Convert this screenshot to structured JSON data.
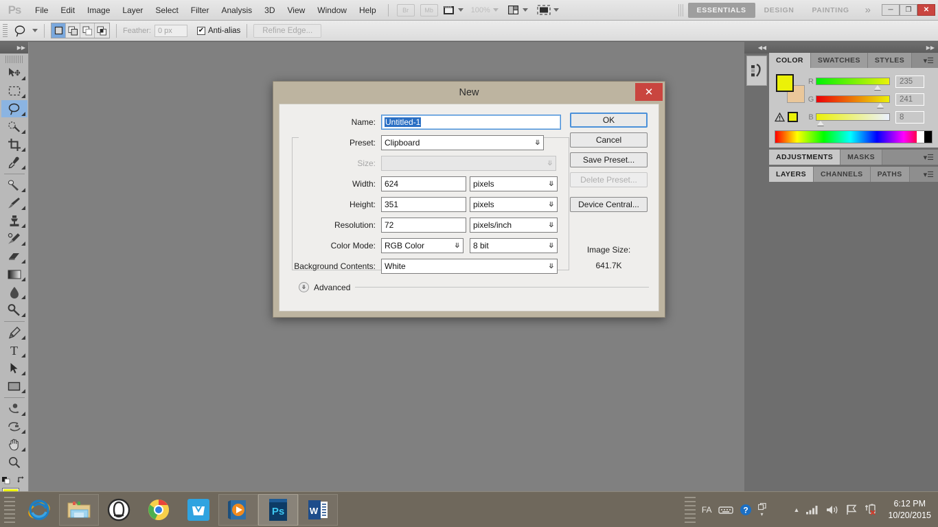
{
  "app": {
    "logo": "Ps"
  },
  "menubar": {
    "items": [
      "File",
      "Edit",
      "Image",
      "Layer",
      "Select",
      "Filter",
      "Analysis",
      "3D",
      "View",
      "Window",
      "Help"
    ],
    "bridge_button": "Br",
    "minibridge_button": "Mb",
    "zoom_level": "100%",
    "workspaces": [
      {
        "label": "ESSENTIALS",
        "active": true
      },
      {
        "label": "DESIGN",
        "active": false
      },
      {
        "label": "PAINTING",
        "active": false
      }
    ],
    "more_workspaces": "»",
    "window_buttons": {
      "minimize": "─",
      "restore": "❐",
      "close": "✕"
    }
  },
  "optionsbar": {
    "tool_icon": "lasso-icon",
    "selection_modes": [
      "new-selection",
      "add-to-selection",
      "subtract-from-selection",
      "intersect-with-selection"
    ],
    "feather_label": "Feather:",
    "feather_value": "0 px",
    "antialias_label": "Anti-alias",
    "antialias_checked": "✔",
    "refine_edge_label": "Refine Edge..."
  },
  "toolbar": {
    "tools": [
      {
        "name": "move-tool",
        "selected": false
      },
      {
        "name": "rectangular-marquee-tool",
        "selected": false
      },
      {
        "name": "lasso-tool",
        "selected": true
      },
      {
        "name": "quick-selection-tool",
        "selected": false
      },
      {
        "name": "crop-tool",
        "selected": false
      },
      {
        "name": "eyedropper-tool",
        "selected": false
      },
      {
        "name": "spot-healing-brush-tool",
        "selected": false
      },
      {
        "name": "brush-tool",
        "selected": false
      },
      {
        "name": "clone-stamp-tool",
        "selected": false
      },
      {
        "name": "history-brush-tool",
        "selected": false
      },
      {
        "name": "eraser-tool",
        "selected": false
      },
      {
        "name": "gradient-tool",
        "selected": false
      },
      {
        "name": "blur-tool",
        "selected": false
      },
      {
        "name": "dodge-tool",
        "selected": false
      },
      {
        "name": "pen-tool",
        "selected": false
      },
      {
        "name": "horizontal-type-tool",
        "selected": false,
        "glyph": "T"
      },
      {
        "name": "path-selection-tool",
        "selected": false
      },
      {
        "name": "rectangle-tool",
        "selected": false
      },
      {
        "name": "3d-rotate-tool",
        "selected": false
      },
      {
        "name": "3d-orbit-tool",
        "selected": false
      },
      {
        "name": "hand-tool",
        "selected": false
      },
      {
        "name": "zoom-tool",
        "selected": false
      }
    ],
    "foreground_color": "#ebf108",
    "background_color": "#eac79a",
    "quick_mask": "edit-in-quick-mask-mode"
  },
  "dialog": {
    "title": "New",
    "close_label": "✕",
    "name_label": "Name:",
    "name_value": "Untitled-1",
    "preset_label": "Preset:",
    "preset_value": "Clipboard",
    "size_label": "Size:",
    "size_value": "",
    "width_label": "Width:",
    "width_value": "624",
    "width_unit": "pixels",
    "height_label": "Height:",
    "height_value": "351",
    "height_unit": "pixels",
    "resolution_label": "Resolution:",
    "resolution_value": "72",
    "resolution_unit": "pixels/inch",
    "color_mode_label": "Color Mode:",
    "color_mode_value": "RGB Color",
    "bit_depth_value": "8 bit",
    "background_label": "Background Contents:",
    "background_value": "White",
    "advanced_label": "Advanced",
    "buttons": {
      "ok": "OK",
      "cancel": "Cancel",
      "save_preset": "Save Preset...",
      "delete_preset": "Delete Preset...",
      "device_central": "Device Central..."
    },
    "image_size_label": "Image Size:",
    "image_size_value": "641.7K"
  },
  "panels": {
    "color": {
      "tabs": [
        {
          "label": "COLOR",
          "active": true
        },
        {
          "label": "SWATCHES",
          "active": false
        },
        {
          "label": "STYLES",
          "active": false
        }
      ],
      "channels": [
        {
          "letter": "R",
          "value": "235"
        },
        {
          "letter": "G",
          "value": "241"
        },
        {
          "letter": "B",
          "value": "8"
        }
      ],
      "foreground_color": "#ebf108",
      "background_color": "#eac79a",
      "out_of_gamut_icon": "warning-icon"
    },
    "adjustments": {
      "tabs": [
        {
          "label": "ADJUSTMENTS",
          "active": true
        },
        {
          "label": "MASKS",
          "active": false
        }
      ]
    },
    "layers": {
      "tabs": [
        {
          "label": "LAYERS",
          "active": true
        },
        {
          "label": "CHANNELS",
          "active": false
        },
        {
          "label": "PATHS",
          "active": false
        }
      ]
    }
  },
  "taskbar": {
    "items": [
      {
        "name": "internet-explorer",
        "active": false,
        "boxed": false
      },
      {
        "name": "file-explorer",
        "active": false,
        "boxed": true
      },
      {
        "name": "opera-browser",
        "active": false,
        "boxed": false
      },
      {
        "name": "google-chrome",
        "active": false,
        "boxed": false
      },
      {
        "name": "store-app",
        "active": false,
        "boxed": false
      },
      {
        "name": "media-player",
        "active": false,
        "boxed": true
      },
      {
        "name": "photoshop",
        "active": true,
        "boxed": true
      },
      {
        "name": "microsoft-word",
        "active": false,
        "boxed": true
      }
    ],
    "tray": {
      "language": "FA",
      "keyboard_icon": "keyboard-icon",
      "help_icon": "help-icon",
      "show_hidden_icon": "chevron-up-icon",
      "network_icon": "network-signal-icon",
      "volume_icon": "speaker-icon",
      "action_center_icon": "flag-icon",
      "battery_icon": "battery-error-icon"
    },
    "time": "6:12 PM",
    "date": "10/20/2015"
  }
}
